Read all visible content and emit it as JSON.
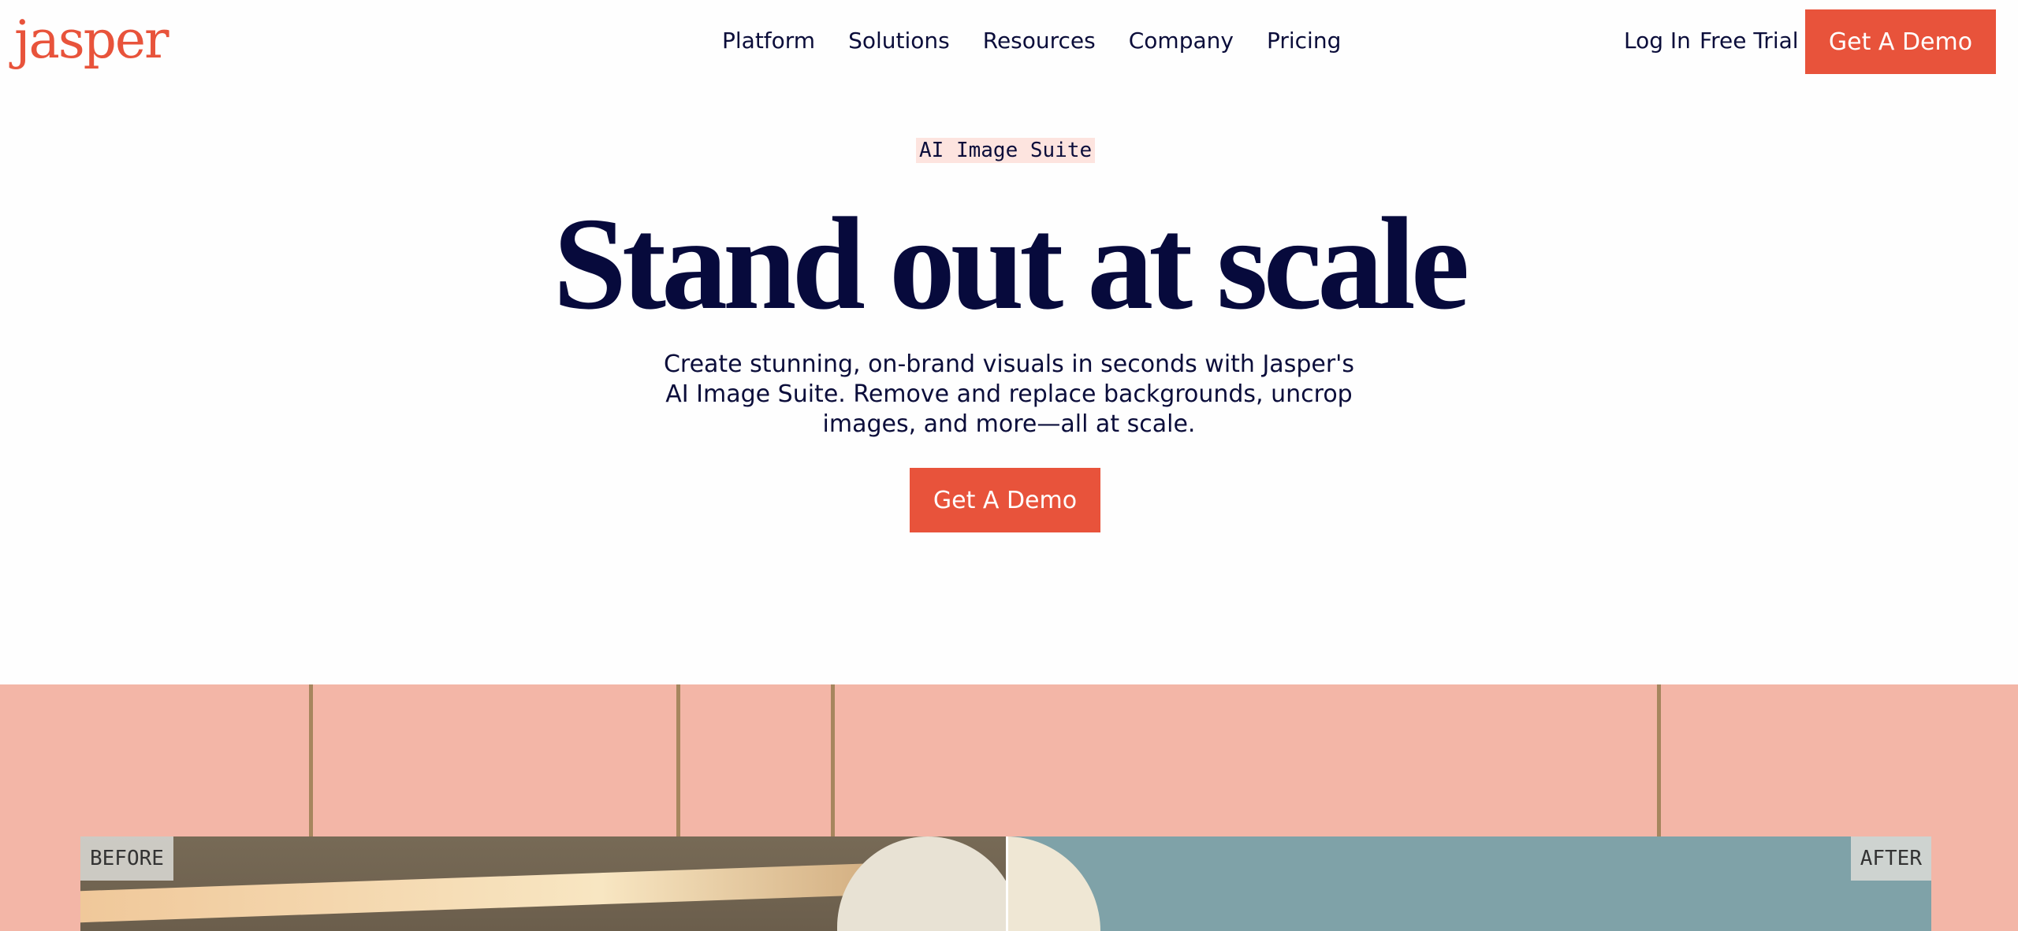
{
  "brand": {
    "logo_text": "jasper",
    "accent_color": "#e8533b",
    "text_color": "#0b0d3a"
  },
  "nav": {
    "items": [
      {
        "label": "Platform"
      },
      {
        "label": "Solutions"
      },
      {
        "label": "Resources"
      },
      {
        "label": "Company"
      },
      {
        "label": "Pricing"
      }
    ],
    "login_label": "Log In",
    "free_trial_label": "Free Trial",
    "cta_label": "Get A Demo"
  },
  "hero": {
    "eyebrow": "AI Image Suite",
    "title": "Stand out at scale",
    "subtitle": "Create stunning, on-brand visuals in seconds with Jasper's AI Image Suite. Remove and replace backgrounds, uncrop images, and more—all at scale.",
    "cta_label": "Get A Demo"
  },
  "showcase": {
    "background_color": "#f3b6a7",
    "before_label": "BEFORE",
    "after_label": "AFTER"
  }
}
